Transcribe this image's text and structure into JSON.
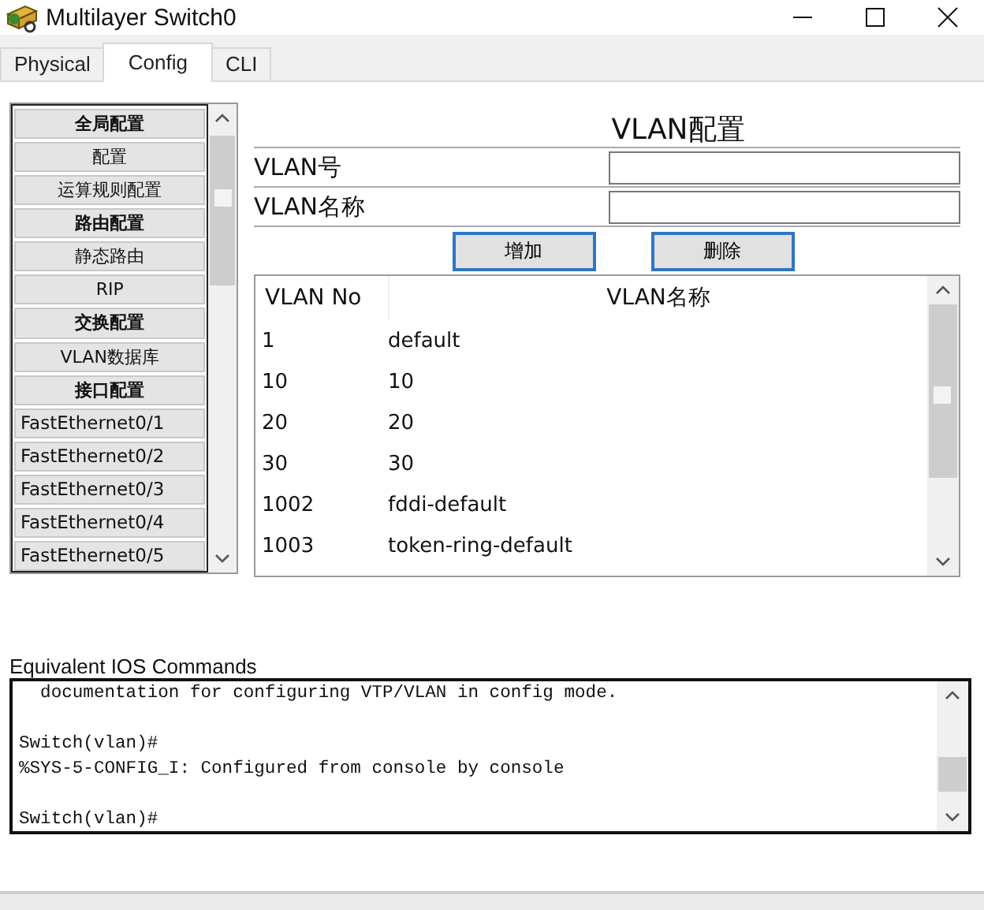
{
  "window": {
    "title": "Multilayer Switch0"
  },
  "tabs": [
    {
      "label": "Physical",
      "selected": false
    },
    {
      "label": "Config",
      "selected": true
    },
    {
      "label": "CLI",
      "selected": false
    }
  ],
  "sidebar": {
    "items": [
      {
        "label": "全局配置",
        "kind": "header"
      },
      {
        "label": "配置",
        "kind": "item"
      },
      {
        "label": "运算规则配置",
        "kind": "item"
      },
      {
        "label": "路由配置",
        "kind": "header"
      },
      {
        "label": "静态路由",
        "kind": "item"
      },
      {
        "label": "RIP",
        "kind": "item"
      },
      {
        "label": "交换配置",
        "kind": "header"
      },
      {
        "label": "VLAN数据库",
        "kind": "item"
      },
      {
        "label": "接口配置",
        "kind": "header"
      },
      {
        "label": "FastEthernet0/1",
        "kind": "port"
      },
      {
        "label": "FastEthernet0/2",
        "kind": "port"
      },
      {
        "label": "FastEthernet0/3",
        "kind": "port"
      },
      {
        "label": "FastEthernet0/4",
        "kind": "port"
      },
      {
        "label": "FastEthernet0/5",
        "kind": "port"
      }
    ]
  },
  "panel": {
    "title": "VLAN配置",
    "fields": [
      {
        "label": "VLAN号"
      },
      {
        "label": "VLAN名称"
      }
    ],
    "buttons": [
      "增加",
      "删除"
    ],
    "table": {
      "columns": [
        "VLAN No",
        "VLAN名称"
      ],
      "rows": [
        [
          "1",
          "default"
        ],
        [
          "10",
          "10"
        ],
        [
          "20",
          "20"
        ],
        [
          "30",
          "30"
        ],
        [
          "1002",
          "fddi-default"
        ],
        [
          "1003",
          "token-ring-default"
        ]
      ]
    }
  },
  "console": {
    "label": "Equivalent IOS Commands",
    "output": "  documentation for configuring VTP/VLAN in config mode.\n\nSwitch(vlan)#\n%SYS-5-CONFIG_I: Configured from console by console\n\nSwitch(vlan)#"
  }
}
